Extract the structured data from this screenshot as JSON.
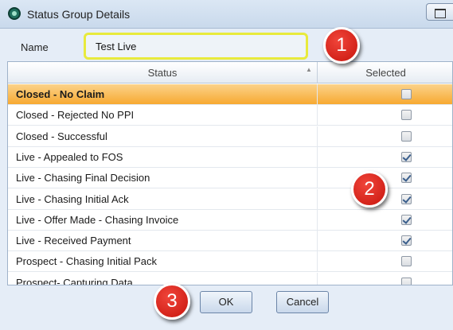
{
  "window": {
    "title": "Status Group Details",
    "icon": "app-logo-icon"
  },
  "form": {
    "name_label": "Name",
    "name_value": "Test Live"
  },
  "grid": {
    "columns": {
      "status": "Status",
      "selected": "Selected"
    },
    "rows": [
      {
        "status": "Closed - No Claim",
        "selected": false,
        "highlighted": true
      },
      {
        "status": "Closed - Rejected No PPI",
        "selected": false
      },
      {
        "status": "Closed - Successful",
        "selected": false
      },
      {
        "status": "Live - Appealed to FOS",
        "selected": true
      },
      {
        "status": "Live - Chasing Final Decision",
        "selected": true
      },
      {
        "status": "Live - Chasing Initial Ack",
        "selected": true
      },
      {
        "status": "Live - Offer Made - Chasing Invoice",
        "selected": true
      },
      {
        "status": "Live - Received Payment",
        "selected": true
      },
      {
        "status": "Prospect - Chasing Initial Pack",
        "selected": false
      },
      {
        "status": "Prospect- Capturing Data",
        "selected": false
      }
    ]
  },
  "buttons": {
    "ok": "OK",
    "cancel": "Cancel"
  },
  "callouts": [
    "1",
    "2",
    "3"
  ],
  "colors": {
    "highlight_row": "#f7a931",
    "callout": "#d8201a",
    "name_focus_border": "#e8ea3c"
  }
}
